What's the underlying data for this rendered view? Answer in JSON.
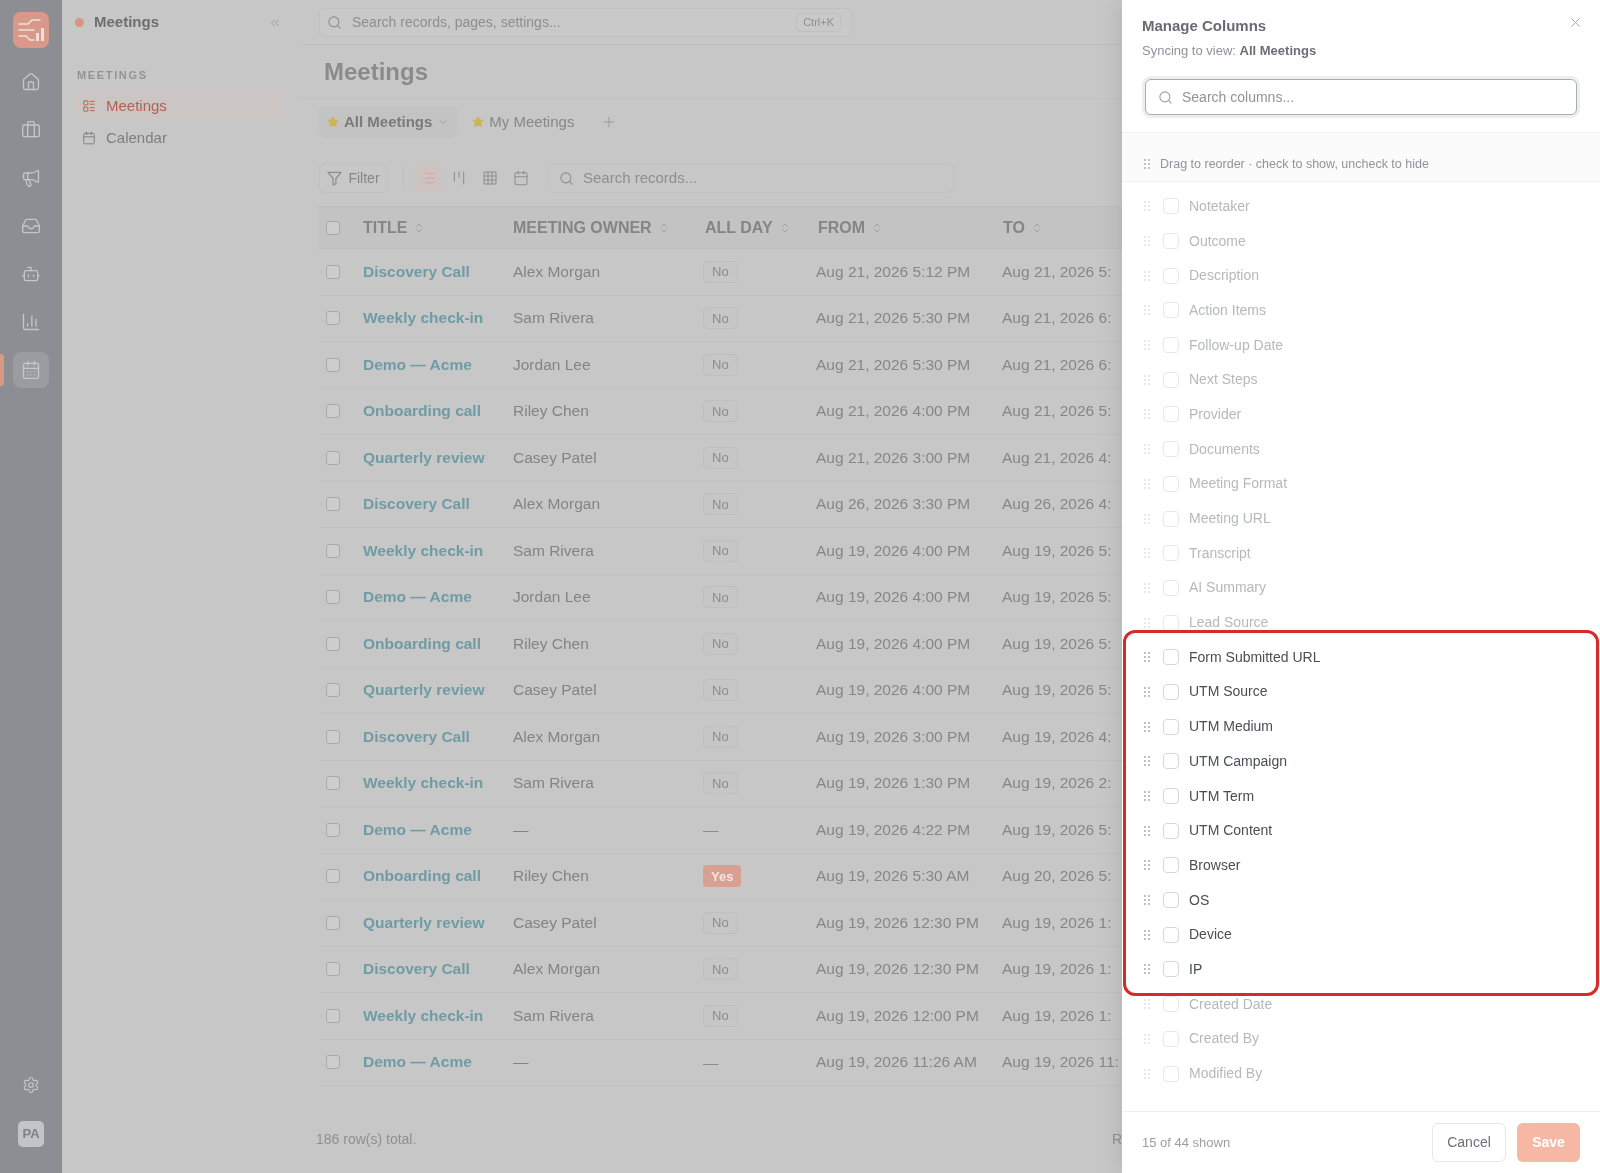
{
  "rail": {
    "items": [
      {
        "selected": false
      },
      {
        "selected": false
      },
      {
        "selected": false
      },
      {
        "selected": false
      },
      {
        "selected": false
      },
      {
        "selected": false
      },
      {
        "selected": true
      }
    ],
    "avatar": "PA"
  },
  "sidebar": {
    "title": "Meetings",
    "section": "MEETINGS",
    "items": [
      {
        "label": "Meetings",
        "selected": true
      },
      {
        "label": "Calendar",
        "selected": false
      }
    ]
  },
  "topbar": {
    "search": {
      "placeholder": "Search records, pages, settings..."
    },
    "shortcut": "Ctrl+K"
  },
  "page": {
    "title": "Meetings",
    "views": [
      {
        "label": "All Meetings",
        "selected": true,
        "starred": true
      },
      {
        "label": "My Meetings",
        "selected": false,
        "starred": true
      }
    ]
  },
  "toolbar": {
    "filter": "Filter",
    "layouts": [
      {
        "selected": true
      },
      {
        "selected": false
      },
      {
        "selected": false
      },
      {
        "selected": false
      }
    ],
    "search": {
      "placeholder": "Search records..."
    }
  },
  "table": {
    "checked": false,
    "columns": [
      "TITLE",
      "MEETING OWNER",
      "ALL DAY",
      "FROM",
      "TO"
    ],
    "rows": [
      {
        "checked": false,
        "title": "Discovery Call",
        "owner": "Alex Morgan",
        "all_day": {
          "kind": "no",
          "text": "No"
        },
        "from": "Aug 21, 2026 5:12 PM",
        "to": "Aug 21, 2026 5:"
      },
      {
        "checked": false,
        "title": "Weekly check-in",
        "owner": "Sam Rivera",
        "all_day": {
          "kind": "no",
          "text": "No"
        },
        "from": "Aug 21, 2026 5:30 PM",
        "to": "Aug 21, 2026 6:"
      },
      {
        "checked": false,
        "title": "Demo — Acme",
        "owner": "Jordan Lee",
        "all_day": {
          "kind": "no",
          "text": "No"
        },
        "from": "Aug 21, 2026 5:30 PM",
        "to": "Aug 21, 2026 6:"
      },
      {
        "checked": false,
        "title": "Onboarding call",
        "owner": "Riley Chen",
        "all_day": {
          "kind": "no",
          "text": "No"
        },
        "from": "Aug 21, 2026 4:00 PM",
        "to": "Aug 21, 2026 5:"
      },
      {
        "checked": false,
        "title": "Quarterly review",
        "owner": "Casey Patel",
        "all_day": {
          "kind": "no",
          "text": "No"
        },
        "from": "Aug 21, 2026 3:00 PM",
        "to": "Aug 21, 2026 4:"
      },
      {
        "checked": false,
        "title": "Discovery Call",
        "owner": "Alex Morgan",
        "all_day": {
          "kind": "no",
          "text": "No"
        },
        "from": "Aug 26, 2026 3:30 PM",
        "to": "Aug 26, 2026 4:"
      },
      {
        "checked": false,
        "title": "Weekly check-in",
        "owner": "Sam Rivera",
        "all_day": {
          "kind": "no",
          "text": "No"
        },
        "from": "Aug 19, 2026 4:00 PM",
        "to": "Aug 19, 2026 5:"
      },
      {
        "checked": false,
        "title": "Demo — Acme",
        "owner": "Jordan Lee",
        "all_day": {
          "kind": "no",
          "text": "No"
        },
        "from": "Aug 19, 2026 4:00 PM",
        "to": "Aug 19, 2026 5:"
      },
      {
        "checked": false,
        "title": "Onboarding call",
        "owner": "Riley Chen",
        "all_day": {
          "kind": "no",
          "text": "No"
        },
        "from": "Aug 19, 2026 4:00 PM",
        "to": "Aug 19, 2026 5:"
      },
      {
        "checked": false,
        "title": "Quarterly review",
        "owner": "Casey Patel",
        "all_day": {
          "kind": "no",
          "text": "No"
        },
        "from": "Aug 19, 2026 4:00 PM",
        "to": "Aug 19, 2026 5:"
      },
      {
        "checked": false,
        "title": "Discovery Call",
        "owner": "Alex Morgan",
        "all_day": {
          "kind": "no",
          "text": "No"
        },
        "from": "Aug 19, 2026 3:00 PM",
        "to": "Aug 19, 2026 4:"
      },
      {
        "checked": false,
        "title": "Weekly check-in",
        "owner": "Sam Rivera",
        "all_day": {
          "kind": "no",
          "text": "No"
        },
        "from": "Aug 19, 2026 1:30 PM",
        "to": "Aug 19, 2026 2:"
      },
      {
        "checked": false,
        "title": "Demo — Acme",
        "owner": "—",
        "all_day": {
          "kind": "empty",
          "text": "—"
        },
        "from": "Aug 19, 2026 4:22 PM",
        "to": "Aug 19, 2026 5:"
      },
      {
        "checked": false,
        "title": "Onboarding call",
        "owner": "Riley Chen",
        "all_day": {
          "kind": "yes",
          "text": "Yes"
        },
        "from": "Aug 19, 2026 5:30 AM",
        "to": "Aug 20, 2026 5:"
      },
      {
        "checked": false,
        "title": "Quarterly review",
        "owner": "Casey Patel",
        "all_day": {
          "kind": "no",
          "text": "No"
        },
        "from": "Aug 19, 2026 12:30 PM",
        "to": "Aug 19, 2026 1:"
      },
      {
        "checked": false,
        "title": "Discovery Call",
        "owner": "Alex Morgan",
        "all_day": {
          "kind": "no",
          "text": "No"
        },
        "from": "Aug 19, 2026 12:30 PM",
        "to": "Aug 19, 2026 1:"
      },
      {
        "checked": false,
        "title": "Weekly check-in",
        "owner": "Sam Rivera",
        "all_day": {
          "kind": "no",
          "text": "No"
        },
        "from": "Aug 19, 2026 12:00 PM",
        "to": "Aug 19, 2026 1:"
      },
      {
        "checked": false,
        "title": "Demo — Acme",
        "owner": "—",
        "all_day": {
          "kind": "empty",
          "text": "—"
        },
        "from": "Aug 19, 2026 11:26 AM",
        "to": "Aug 19, 2026 11:"
      }
    ]
  },
  "footer": {
    "total": "186 row(s) total.",
    "column_2": "R"
  },
  "drawer": {
    "title": "Manage Columns",
    "subtitle": "Syncing to view: **All Meetings**",
    "search": {
      "placeholder": "Search columns..."
    },
    "hint": "Drag to reorder · check to show, uncheck to hide",
    "columns": [
      {
        "label": "Notetaker",
        "checked": false,
        "highlighted": false
      },
      {
        "label": "Outcome",
        "checked": false,
        "highlighted": false
      },
      {
        "label": "Description",
        "checked": false,
        "highlighted": false
      },
      {
        "label": "Action Items",
        "checked": false,
        "highlighted": false
      },
      {
        "label": "Follow-up Date",
        "checked": false,
        "highlighted": false
      },
      {
        "label": "Next Steps",
        "checked": false,
        "highlighted": false
      },
      {
        "label": "Provider",
        "checked": false,
        "highlighted": false
      },
      {
        "label": "Documents",
        "checked": false,
        "highlighted": false
      },
      {
        "label": "Meeting Format",
        "checked": false,
        "highlighted": false
      },
      {
        "label": "Meeting URL",
        "checked": false,
        "highlighted": false
      },
      {
        "label": "Transcript",
        "checked": false,
        "highlighted": false
      },
      {
        "label": "AI Summary",
        "checked": false,
        "highlighted": false
      },
      {
        "label": "Lead Source",
        "checked": false,
        "highlighted": false
      },
      {
        "label": "Form Submitted URL",
        "checked": false,
        "highlighted": true
      },
      {
        "label": "UTM Source",
        "checked": false,
        "highlighted": true
      },
      {
        "label": "UTM Medium",
        "checked": false,
        "highlighted": true
      },
      {
        "label": "UTM Campaign",
        "checked": false,
        "highlighted": true
      },
      {
        "label": "UTM Term",
        "checked": false,
        "highlighted": true
      },
      {
        "label": "UTM Content",
        "checked": false,
        "highlighted": true
      },
      {
        "label": "Browser",
        "checked": false,
        "highlighted": true
      },
      {
        "label": "OS",
        "checked": false,
        "highlighted": true
      },
      {
        "label": "Device",
        "checked": false,
        "highlighted": true
      },
      {
        "label": "IP",
        "checked": false,
        "highlighted": true
      },
      {
        "label": "Created Date",
        "checked": false,
        "highlighted": false
      },
      {
        "label": "Created By",
        "checked": false,
        "highlighted": false
      },
      {
        "label": "Modified By",
        "checked": false,
        "highlighted": false
      }
    ],
    "count": "15 of 44 shown",
    "buttons": [
      {
        "label": "Cancel",
        "kind": "secondary",
        "disabled": false
      },
      {
        "label": "Save",
        "kind": "primary",
        "disabled": true
      }
    ]
  }
}
